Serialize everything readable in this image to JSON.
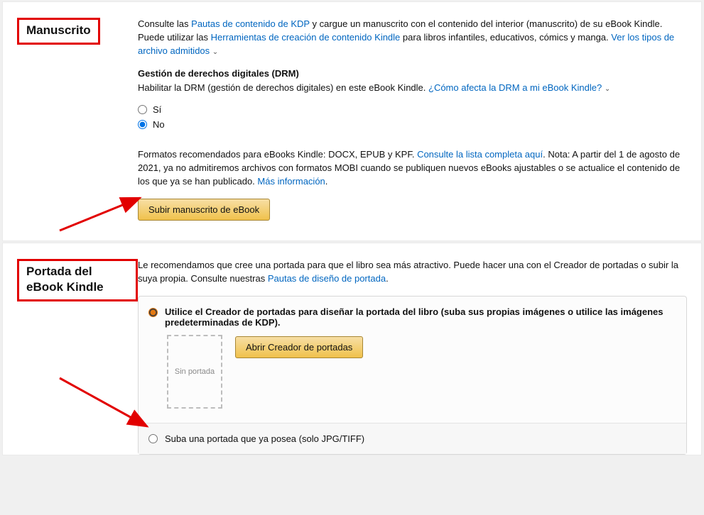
{
  "manuscript": {
    "title": "Manuscrito",
    "intro1": "Consulte las ",
    "link1": "Pautas de contenido de KDP",
    "intro2": " y cargue un manuscrito con el contenido del interior (manuscrito) de su eBook Kindle. Puede utilizar las ",
    "link2": "Herramientas de creación de contenido Kindle",
    "intro3": " para libros infantiles, educativos, cómics y manga. ",
    "link3": "Ver los tipos de archivo admitidos",
    "drm_heading": "Gestión de derechos digitales (DRM)",
    "drm_text": "Habilitar la DRM (gestión de derechos digitales) en este eBook Kindle. ",
    "drm_link": "¿Cómo afecta la DRM a mi eBook Kindle?",
    "radio_yes": "Sí",
    "radio_no": "No",
    "formats1": "Formatos recomendados para eBooks Kindle: DOCX, EPUB y KPF. ",
    "formats_link1": "Consulte la lista completa aquí",
    "formats2": ". Nota: A partir del 1 de agosto de 2021, ya no admitiremos archivos con formatos MOBI cuando se publiquen nuevos eBooks ajustables o se actualice el contenido de los que ya se han publicado. ",
    "formats_link2": "Más información",
    "upload_btn": "Subir manuscrito de eBook"
  },
  "cover": {
    "title": "Portada del eBook Kindle",
    "intro1": "Le recomendamos que cree una portada para que el libro sea más atractivo. Puede hacer una con el Creador de portadas o subir la suya propia. Consulte nuestras ",
    "link1": "Pautas de diseño de portada",
    "opt1_label": "Utilice el Creador de portadas para diseñar la portada del libro (suba sus propias imágenes o utilice las imágenes predeterminadas de KDP).",
    "thumb_text": "Sin portada",
    "open_creator_btn": "Abrir Creador de portadas",
    "opt2_label": "Suba una portada que ya posea (solo JPG/TIFF)"
  }
}
